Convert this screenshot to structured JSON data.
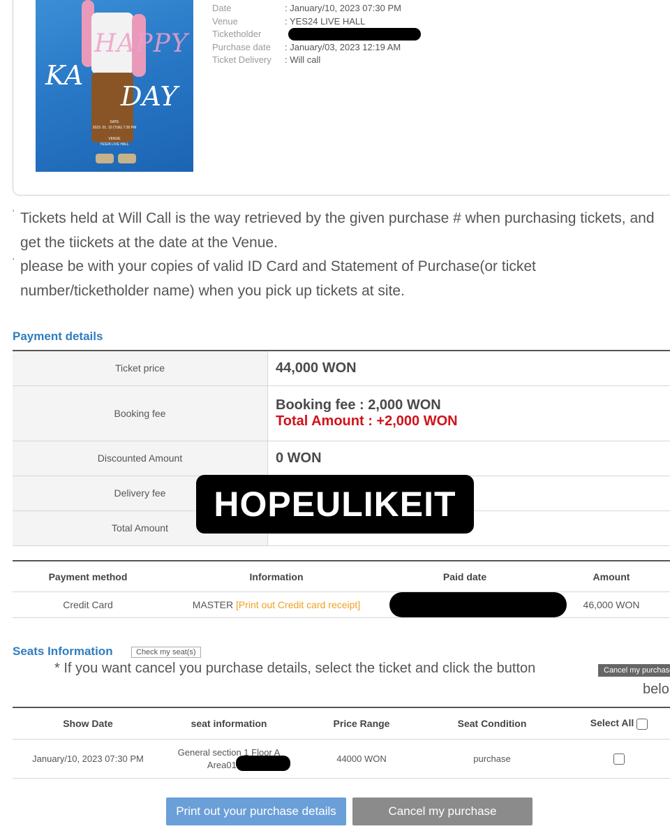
{
  "poster": {
    "title_line1": "HAPPY",
    "title_ka": "KA",
    "title_day": "DAY",
    "small_date": "2023. 01. 10 (TUE) 7:30 PM",
    "small_venue": "YES24 LIVE HALL",
    "tag_date": "DATE",
    "tag_venue": "VENUE"
  },
  "ticket_info": {
    "date_label": "Date",
    "date_value": ": January/10, 2023 07:30 PM",
    "venue_label": "Venue",
    "venue_value": ": YES24 LIVE HALL",
    "ticketholder_label": "Ticketholder",
    "purchase_date_label": "Purchase date",
    "purchase_date_value": ": January/03, 2023 12:19 AM",
    "delivery_label": "Ticket Delivery",
    "delivery_value": ": Will call"
  },
  "notes": [
    "Tickets held at Will Call is the way retrieved by the given purchase # when purchasing tickets, and get the tiickets at the date at the Venue.",
    "please be with your copies of valid ID Card and Statement of Purchase(or ticket number/ticketholder name) when you pick up tickets at site."
  ],
  "payment_details": {
    "title": "Payment details",
    "rows": [
      {
        "label": "Ticket price",
        "value": "44,000 WON"
      },
      {
        "label": "Booking fee",
        "value": "Booking fee : 2,000 WON",
        "value2": "Total Amount : +2,000 WON"
      },
      {
        "label": "Discounted Amount",
        "value": "0 WON"
      },
      {
        "label": "Delivery fee",
        "value": ""
      },
      {
        "label": "Total Amount",
        "value": ""
      }
    ]
  },
  "payment_method_table": {
    "headers": [
      "Payment method",
      "Information",
      "Paid date",
      "Amount"
    ],
    "row": {
      "method": "Credit Card",
      "info_text": "MASTER",
      "info_link": "[Print out Credit card receipt]",
      "amount": "46,000 WON"
    }
  },
  "seats": {
    "title": "Seats Information",
    "check_button": "Check my seat(s)",
    "cancel_note": "* If you want cancel you purchase details, select the ticket and click the button",
    "cancel_inline_button": "Cancel my purchase",
    "cancel_note_tail": "belo",
    "headers": [
      "Show Date",
      "seat information",
      "Price Range",
      "Seat Condition",
      "Select All"
    ],
    "row": {
      "show_date": "January/10, 2023 07:30 PM",
      "seat_line1": "General section 1 Floor A",
      "seat_line2": "Area01 Ro",
      "price": "44000 WON",
      "condition": "purchase"
    }
  },
  "buttons": {
    "print": "Print out your purchase details",
    "cancel": "Cancel my purchase"
  },
  "watermark": "HOPEULIKEIT",
  "colors": {
    "section_title": "#2f7dbf",
    "red": "#d0121a",
    "orange_link": "#f0a020",
    "blue_link": "#2aa0d8",
    "print_button": "#6a9fd8",
    "cancel_button": "#8b8b8b"
  }
}
